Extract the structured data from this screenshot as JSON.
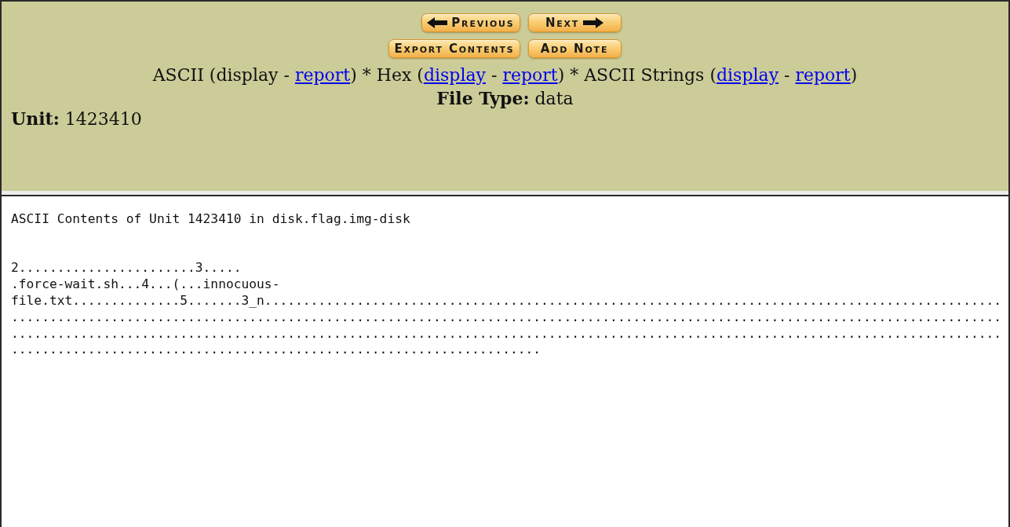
{
  "toolbar": {
    "buttons": [
      {
        "label": "Previous",
        "kind": "back"
      },
      {
        "label": "Next",
        "kind": "forward"
      },
      {
        "label": "Export Contents",
        "kind": "plain"
      },
      {
        "label": "Add Note",
        "kind": "plain"
      }
    ]
  },
  "view_modes": [
    {
      "kind": "text",
      "text": "ASCII (display - "
    },
    {
      "kind": "link",
      "text": "report"
    },
    {
      "kind": "text",
      "text": ") * Hex ("
    },
    {
      "kind": "link",
      "text": "display"
    },
    {
      "kind": "text",
      "text": " - "
    },
    {
      "kind": "link",
      "text": "report"
    },
    {
      "kind": "text",
      "text": ") * ASCII Strings ("
    },
    {
      "kind": "link",
      "text": "display"
    },
    {
      "kind": "text",
      "text": " - "
    },
    {
      "kind": "link",
      "text": "report"
    },
    {
      "kind": "text",
      "text": ")"
    }
  ],
  "file_type": {
    "label": "File Type:",
    "value": "data"
  },
  "unit": {
    "label": "Unit:",
    "value": "1423410"
  },
  "contents": {
    "title": "ASCII Contents of Unit 1423410 in disk.flag.img-disk",
    "lines": [
      "2.......................3.....",
      ".force-wait.sh...4...(...innocuous-",
      "file.txt..............5.......3_n................................................................................................",
      ".................................................................................................................................",
      ".................................................................................................................................",
      "....................................................................."
    ]
  }
}
